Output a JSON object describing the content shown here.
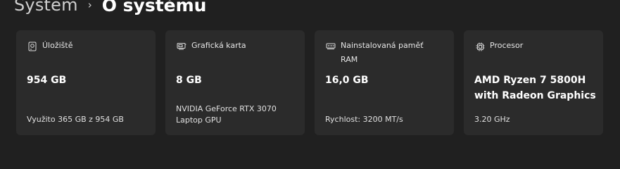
{
  "breadcrumb": {
    "parent": "Systém",
    "separator": "›",
    "current": "O systému"
  },
  "cards": [
    {
      "icon": "hard-drive-icon",
      "label": "Úložiště",
      "value": "954 GB",
      "sub": "Využito 365 GB z 954 GB"
    },
    {
      "icon": "graphics-card-icon",
      "label": "Grafická karta",
      "value": "8 GB",
      "sub": "NVIDIA GeForce RTX 3070 Laptop GPU"
    },
    {
      "icon": "memory-icon",
      "label": "Nainstalovaná paměť RAM",
      "value": "16,0 GB",
      "sub": "Rychlost: 3200 MT/s"
    },
    {
      "icon": "processor-icon",
      "label": "Procesor",
      "value": "AMD Ryzen 7 5800H with Radeon Graphics",
      "sub": "3.20 GHz"
    }
  ]
}
